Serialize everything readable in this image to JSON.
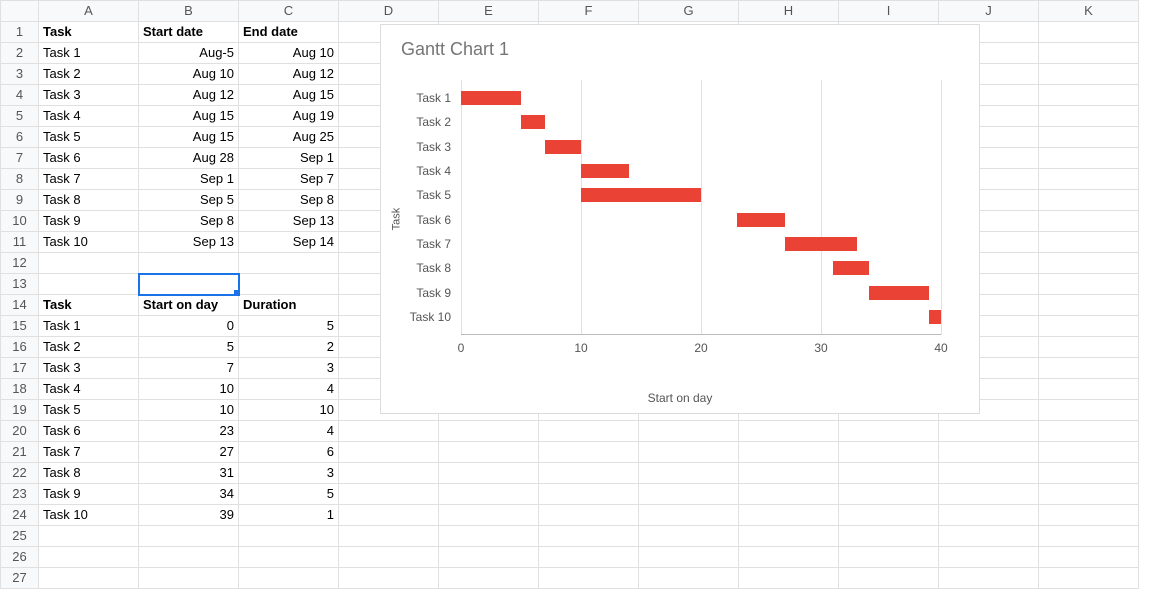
{
  "columns": [
    "A",
    "B",
    "C",
    "D",
    "E",
    "F",
    "G",
    "H",
    "I",
    "J",
    "K"
  ],
  "row_count": 27,
  "selected_cell": {
    "row": 13,
    "col": 1
  },
  "table1": {
    "header_row": 1,
    "headers": [
      "Task",
      "Start date",
      "End date"
    ],
    "rows": [
      [
        "Task 1",
        "Aug-5",
        "Aug 10"
      ],
      [
        "Task 2",
        "Aug 10",
        "Aug 12"
      ],
      [
        "Task 3",
        "Aug 12",
        "Aug 15"
      ],
      [
        "Task 4",
        "Aug 15",
        "Aug 19"
      ],
      [
        "Task 5",
        "Aug 15",
        "Aug 25"
      ],
      [
        "Task 6",
        "Aug 28",
        "Sep 1"
      ],
      [
        "Task 7",
        "Sep 1",
        "Sep 7"
      ],
      [
        "Task 8",
        "Sep 5",
        "Sep 8"
      ],
      [
        "Task 9",
        "Sep 8",
        "Sep 13"
      ],
      [
        "Task 10",
        "Sep 13",
        "Sep 14"
      ]
    ]
  },
  "table2": {
    "header_row": 14,
    "headers": [
      "Task",
      "Start on day",
      "Duration"
    ],
    "rows": [
      [
        "Task 1",
        "0",
        "5"
      ],
      [
        "Task 2",
        "5",
        "2"
      ],
      [
        "Task 3",
        "7",
        "3"
      ],
      [
        "Task 4",
        "10",
        "4"
      ],
      [
        "Task 5",
        "10",
        "10"
      ],
      [
        "Task 6",
        "23",
        "4"
      ],
      [
        "Task 7",
        "27",
        "6"
      ],
      [
        "Task 8",
        "31",
        "3"
      ],
      [
        "Task 9",
        "34",
        "5"
      ],
      [
        "Task 10",
        "39",
        "1"
      ]
    ]
  },
  "chart_title": "Gantt Chart 1",
  "chart_xlabel": "Start on day",
  "chart_ylabel": "Task",
  "chart_ticks": [
    0,
    10,
    20,
    30,
    40
  ],
  "chart_data": {
    "type": "bar",
    "orientation": "horizontal",
    "categories": [
      "Task 1",
      "Task 2",
      "Task 3",
      "Task 4",
      "Task 5",
      "Task 6",
      "Task 7",
      "Task 8",
      "Task 9",
      "Task 10"
    ],
    "series": [
      {
        "name": "Start on day",
        "values": [
          0,
          5,
          7,
          10,
          10,
          23,
          27,
          31,
          34,
          39
        ],
        "color": "transparent"
      },
      {
        "name": "Duration",
        "values": [
          5,
          2,
          3,
          4,
          10,
          4,
          6,
          3,
          5,
          1
        ],
        "color": "#ea4335"
      }
    ],
    "title": "Gantt Chart 1",
    "xlabel": "Start on day",
    "ylabel": "Task",
    "xlim": [
      0,
      40
    ]
  }
}
